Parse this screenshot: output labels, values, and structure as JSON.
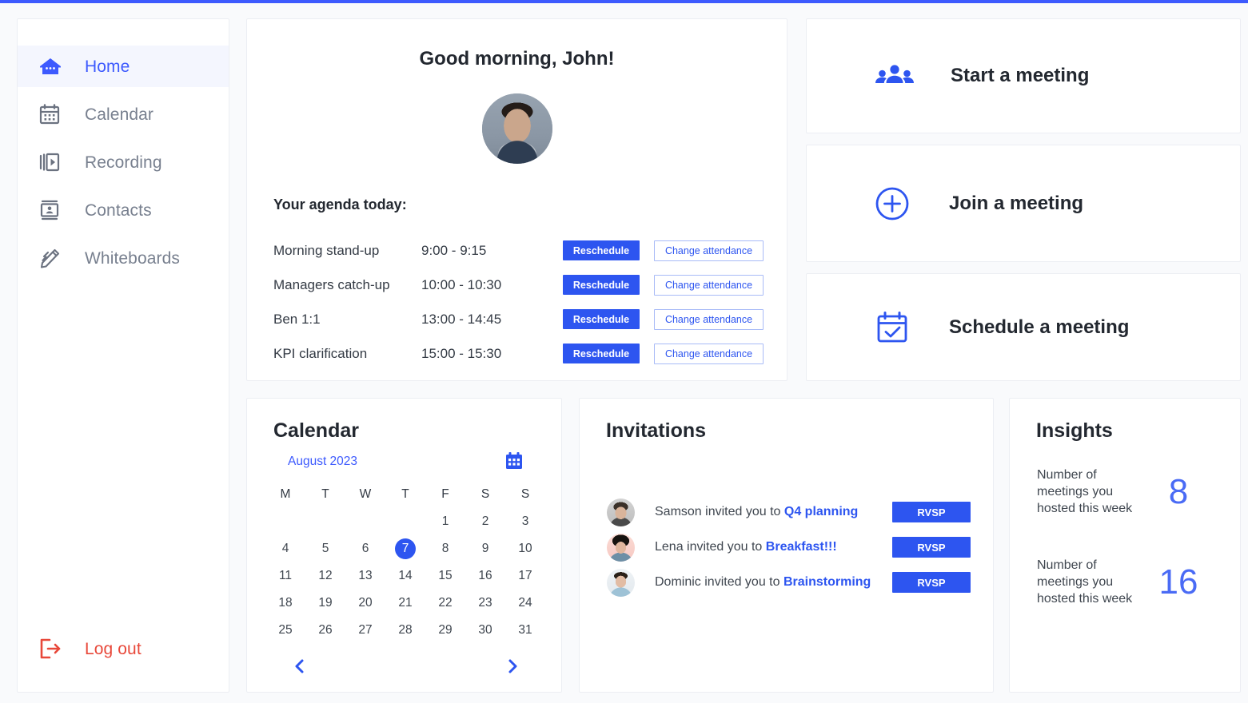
{
  "theme": {
    "accent": "#3d5afe",
    "button_blue": "#2d55f0",
    "logout_red": "#e8483a",
    "page_bg": "#f9fafc"
  },
  "sidebar": {
    "items": [
      {
        "label": "Home",
        "icon": "home-icon",
        "active": true
      },
      {
        "label": "Calendar",
        "icon": "calendar-icon",
        "active": false
      },
      {
        "label": "Recording",
        "icon": "recording-icon",
        "active": false
      },
      {
        "label": "Contacts",
        "icon": "contacts-icon",
        "active": false
      },
      {
        "label": "Whiteboards",
        "icon": "whiteboard-icon",
        "active": false
      }
    ],
    "logout": {
      "label": "Log out",
      "icon": "logout-icon"
    }
  },
  "greeting": {
    "title": "Good morning, John!",
    "avatar": "user-avatar",
    "agenda_label": "Your agenda today:",
    "reschedule_label": "Reschedule",
    "change_attendance_label": "Change attendance",
    "agenda": [
      {
        "name": "Morning stand-up",
        "time": "9:00 - 9:15"
      },
      {
        "name": "Managers catch-up",
        "time": "10:00 - 10:30"
      },
      {
        "name": "Ben 1:1",
        "time": "13:00 - 14:45"
      },
      {
        "name": "KPI clarification",
        "time": "15:00 - 15:30"
      }
    ]
  },
  "actions": {
    "start": {
      "label": "Start a meeting",
      "icon": "people-group-icon"
    },
    "join": {
      "label": "Join a meeting",
      "icon": "plus-circle-icon"
    },
    "schedule": {
      "label": "Schedule a meeting",
      "icon": "calendar-check-icon"
    }
  },
  "calendar": {
    "title": "Calendar",
    "month": "August 2023",
    "picker_icon": "calendar-picker-icon",
    "prev_icon": "chevron-left-icon",
    "next_icon": "chevron-right-icon",
    "dow": [
      "M",
      "T",
      "W",
      "T",
      "F",
      "S",
      "S"
    ],
    "leading_blanks": 4,
    "days": [
      1,
      2,
      3,
      4,
      5,
      6,
      7,
      8,
      9,
      10,
      11,
      12,
      13,
      14,
      15,
      16,
      17,
      18,
      19,
      20,
      21,
      22,
      23,
      24,
      25,
      26,
      27,
      28,
      29,
      30,
      31
    ],
    "selected_day": 7
  },
  "invitations": {
    "title": "Invitations",
    "rvsp_label": "RVSP",
    "items": [
      {
        "prefix": "Samson invited you to",
        "meeting": "Q4 planning",
        "avatar": "avatar-samson"
      },
      {
        "prefix": "Lena invited you to",
        "meeting": "Breakfast!!!",
        "avatar": "avatar-lena"
      },
      {
        "prefix": "Dominic invited you to",
        "meeting": "Brainstorming",
        "avatar": "avatar-dominic"
      }
    ]
  },
  "insights": {
    "title": "Insights",
    "items": [
      {
        "text": "Number of meetings you hosted this week",
        "value": "8"
      },
      {
        "text": "Number of meetings you hosted this week",
        "value": "16"
      }
    ]
  }
}
